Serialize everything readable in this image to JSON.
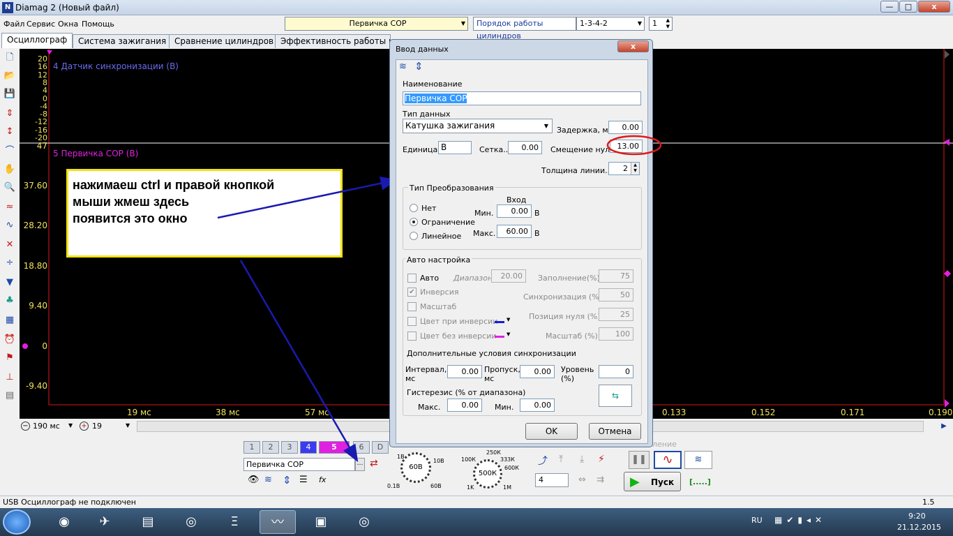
{
  "window": {
    "title": "Diamag 2 (Новый файл)",
    "min": "—",
    "max": "□",
    "close": "x"
  },
  "menu": [
    "Файл",
    "Сервис",
    "Окна",
    "Помощь"
  ],
  "toolbar": {
    "channel_select": "Первичка СОР",
    "order_label": "Порядок работы цилиндров",
    "order_value": "1-3-4-2",
    "cyl_value": "1"
  },
  "tabs": [
    "Осциллограф",
    "Система зажигания",
    "Сравнение цилиндров",
    "Эффективность работы цил"
  ],
  "scope": {
    "ch4_label": "4 Датчик синхронизации (В)",
    "ch5_label": "5 Первичка СОР (В)",
    "y_top": [
      "20",
      "16",
      "12",
      "8",
      "4",
      "0",
      "-4",
      "-8",
      "-12",
      "-16",
      "-20"
    ],
    "y_bottom": [
      "47",
      "37.60",
      "28.20",
      "18.80",
      "9.40",
      "0",
      "-9.40"
    ],
    "x_ticks_left": [
      "19 мс",
      "38 мс",
      "57 мс"
    ],
    "x_ticks_right": [
      "0.133",
      "0.152",
      "0.171",
      "0.190"
    ]
  },
  "bottombar": {
    "timebase": "190 мс",
    "pos": "19"
  },
  "callout": {
    "line1": "нажимаеш ctrl и правой кнопкой",
    "line2": "мыши жмеш здесь",
    "line3": "появится это окно"
  },
  "dialog": {
    "title": "Ввод данных",
    "close": "x",
    "name_label": "Наименование",
    "name_value": "Первичка СОР",
    "type_label": "Тип данных",
    "type_value": "Катушка зажигания",
    "delay_label": "Задержка, мс",
    "delay_value": "0.00",
    "unit_label": "Единица...",
    "unit_value": "В",
    "grid_label": "Сетка...",
    "grid_value": "0.00",
    "offset_label": "Смещение нуля",
    "offset_value": "13.00",
    "thickness_label": "Толщина линии...",
    "thickness_value": "2",
    "conv": {
      "title": "Тип Преобразования",
      "input_label": "Вход",
      "none": "Нет",
      "limit": "Ограничение",
      "linear": "Линейное",
      "min_label": "Мин.",
      "min_value": "0.00",
      "max_label": "Макс.",
      "max_value": "60.00",
      "unit": "В"
    },
    "auto": {
      "title": "Авто настройка",
      "auto": "Авто",
      "inversion": "Инверсия",
      "scale": "Масштаб",
      "color_inv": "Цвет при инверсии",
      "color_noinv": "Цвет без инверсии",
      "range_label": "Диапазон.",
      "range_value": "20.00",
      "fill_label": "Заполнение(%)",
      "fill_value": "75",
      "sync_label": "Синхронизация (%)",
      "sync_value": "50",
      "zero_label": "Позиция нуля (%)",
      "zero_value": "25",
      "scale_label": "Масштаб (%)",
      "scale_value": "100",
      "color_inv_hex": "#1a1adb",
      "color_noinv_hex": "#e020e0"
    },
    "sync": {
      "title": "Дополнительные условия синхронизации",
      "interval_label": "Интервал,",
      "interval_unit": "мс",
      "interval_value": "0.00",
      "skip_label": "Пропуск,",
      "skip_unit": "мс",
      "skip_value": "0.00",
      "level_label": "Уровень",
      "level_unit": "(%)",
      "level_value": "0",
      "hyst_title": "Гистерезис (% от диапазона)",
      "hmax_label": "Макс.",
      "hmax_value": "0.00",
      "hmin_label": "Мин.",
      "hmin_value": "0.00"
    },
    "ok": "OK",
    "cancel": "Отмена"
  },
  "panel": {
    "channels": [
      "1",
      "2",
      "3",
      "4",
      "5",
      "6",
      "D"
    ],
    "channel_name": "Первичка СОР",
    "knob1_value": "60В",
    "knob1_labels": [
      "1В",
      "10В",
      "0.1В",
      "60В"
    ],
    "knob2_value": "500К",
    "knob2_labels": [
      "100К",
      "250К",
      "333К",
      "600К",
      "1K",
      "1M"
    ],
    "trig_value": "4",
    "start": "Пуск",
    "status_dots": "[.....]",
    "partial_label": "ление"
  },
  "status": {
    "text": "USB Осциллограф не подключен",
    "right": "1.5"
  },
  "taskbar": {
    "lang": "RU",
    "time": "9:20",
    "date": "21.12.2015"
  }
}
